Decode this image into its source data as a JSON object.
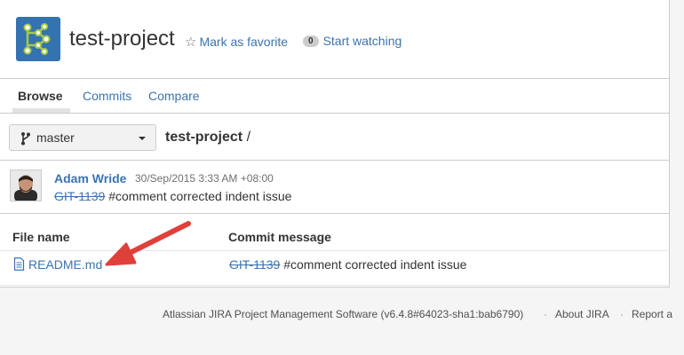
{
  "project": {
    "name": "test-project",
    "favorite_label": "Mark as favorite",
    "watch_count": "0",
    "watch_label": "Start watching"
  },
  "tabs": [
    {
      "label": "Browse",
      "active": true
    },
    {
      "label": "Commits"
    },
    {
      "label": "Compare"
    }
  ],
  "branch": {
    "selected": "master",
    "path_project": "test-project",
    "path_separator": "/"
  },
  "latest_commit": {
    "author": "Adam Wride",
    "timestamp": "30/Sep/2015 3:33 AM +08:00",
    "issue_key": "GIT-1139",
    "message": "#comment corrected indent issue"
  },
  "file_table": {
    "headers": [
      "File name",
      "Commit message"
    ],
    "rows": [
      {
        "file": "README.md",
        "issue_key": "GIT-1139",
        "message": "#comment corrected indent issue"
      }
    ]
  },
  "footer": {
    "software": "Atlassian JIRA Project Management Software (v6.4.8#64023-sha1:bab6790)",
    "about": "About JIRA",
    "report": "Report a"
  },
  "colors": {
    "link": "#3b73af",
    "logo_bg": "#3572b0",
    "annotation_arrow": "#e0403a"
  },
  "icons": {
    "logo": "repository-graph-icon",
    "favorite": "star-outline-icon",
    "branch": "git-branch-icon",
    "file": "document-icon"
  }
}
